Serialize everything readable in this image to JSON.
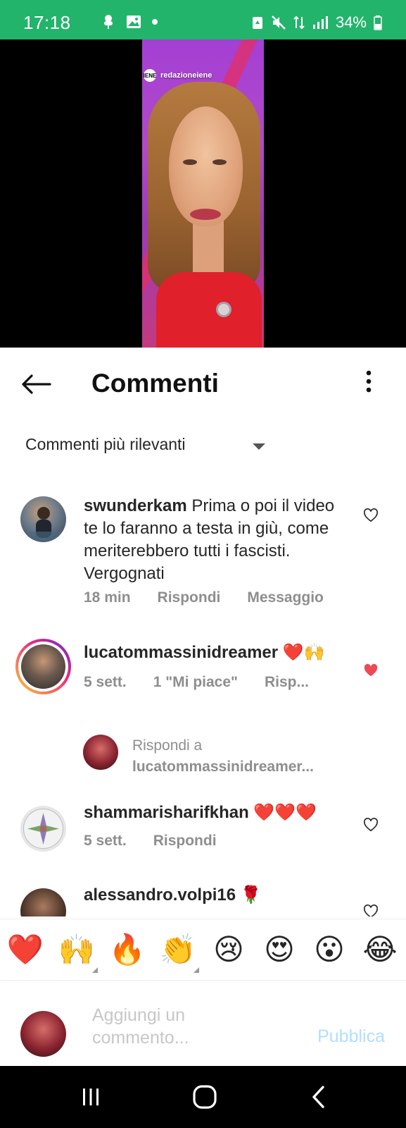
{
  "status_bar": {
    "time": "17:18",
    "left_icons": [
      "tree-icon",
      "image-icon",
      "dot-icon"
    ],
    "battery": "34%",
    "right_icons": [
      "recycle-icon",
      "mute-icon",
      "data-arrows-icon",
      "signal-icon",
      "battery-icon"
    ],
    "color": "#22b46b"
  },
  "video": {
    "username": "redazioneiene",
    "avatar_text": "IENE"
  },
  "header": {
    "title": "Commenti"
  },
  "sort": {
    "label": "Commenti più rilevanti"
  },
  "comments": [
    {
      "username": "swunderkam",
      "text": " Prima o poi il video te lo faranno a testa in giù, come meriterebbero tutti i fascisti. Vergognati",
      "time": "18 min",
      "reply_label": "Rispondi",
      "message_label": "Messaggio",
      "liked": false
    },
    {
      "username": "lucatommassinidreamer",
      "text": " ❤️🙌",
      "time": "5 sett.",
      "likes": "1 \"Mi piace\"",
      "reply_label": "Risp...",
      "liked": true
    },
    {
      "username": "shammarisharifkhan",
      "text": " ❤️❤️❤️",
      "time": "5 sett.",
      "reply_label": "Rispondi",
      "liked": false
    },
    {
      "username": "alessandro.volpi16",
      "text": " 🌹",
      "liked": false
    }
  ],
  "reply_thread": {
    "prefix": "Rispondi a",
    "target": "lucatommassinidreamer..."
  },
  "emoji_bar": [
    "❤️",
    "🙌",
    "🔥",
    "👏",
    "😢",
    "😍",
    "😮",
    "😂"
  ],
  "composer": {
    "placeholder": "Aggiungi un commento...",
    "publish_label": "Pubblica",
    "publish_color": "#b2dffc"
  },
  "colors": {
    "liked_heart": "#ed4956",
    "meta_text": "#8e8e8e",
    "accent_ring_start": "#f9ce34",
    "accent_ring_end": "#ee2a7b"
  }
}
